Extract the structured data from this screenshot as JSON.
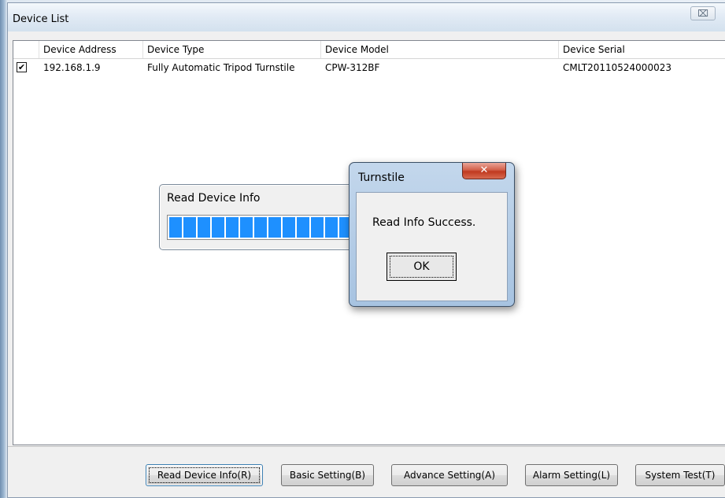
{
  "window": {
    "title": "Device List",
    "close_glyph": "⌧"
  },
  "table": {
    "columns": [
      "Device Address",
      "Device Type",
      "Device Model",
      "Device Serial"
    ],
    "rows": [
      {
        "checked": true,
        "check_glyph": "✔",
        "address": "192.168.1.9",
        "type": "Fully Automatic Tripod Turnstile",
        "model": "CPW-312BF",
        "serial": "CMLT20110524000023"
      }
    ]
  },
  "buttons": {
    "read": "Read Device Info(R)",
    "basic": "Basic Setting(B)",
    "advance": "Advance Setting(A)",
    "alarm": "Alarm Setting(L)",
    "system": "System Test(T)"
  },
  "progress": {
    "title": "Read Device Info",
    "value_percent": 100
  },
  "message_box": {
    "title": "Turnstile",
    "close_glyph": "✕",
    "text": "Read Info Success.",
    "ok_label": "OK"
  },
  "colors": {
    "progress_fill": "#1e90ff",
    "close_red": "#c0391f"
  },
  "icons": {
    "checkbox": "check-icon",
    "window_close": "close-icon",
    "dialog_close": "close-icon"
  }
}
